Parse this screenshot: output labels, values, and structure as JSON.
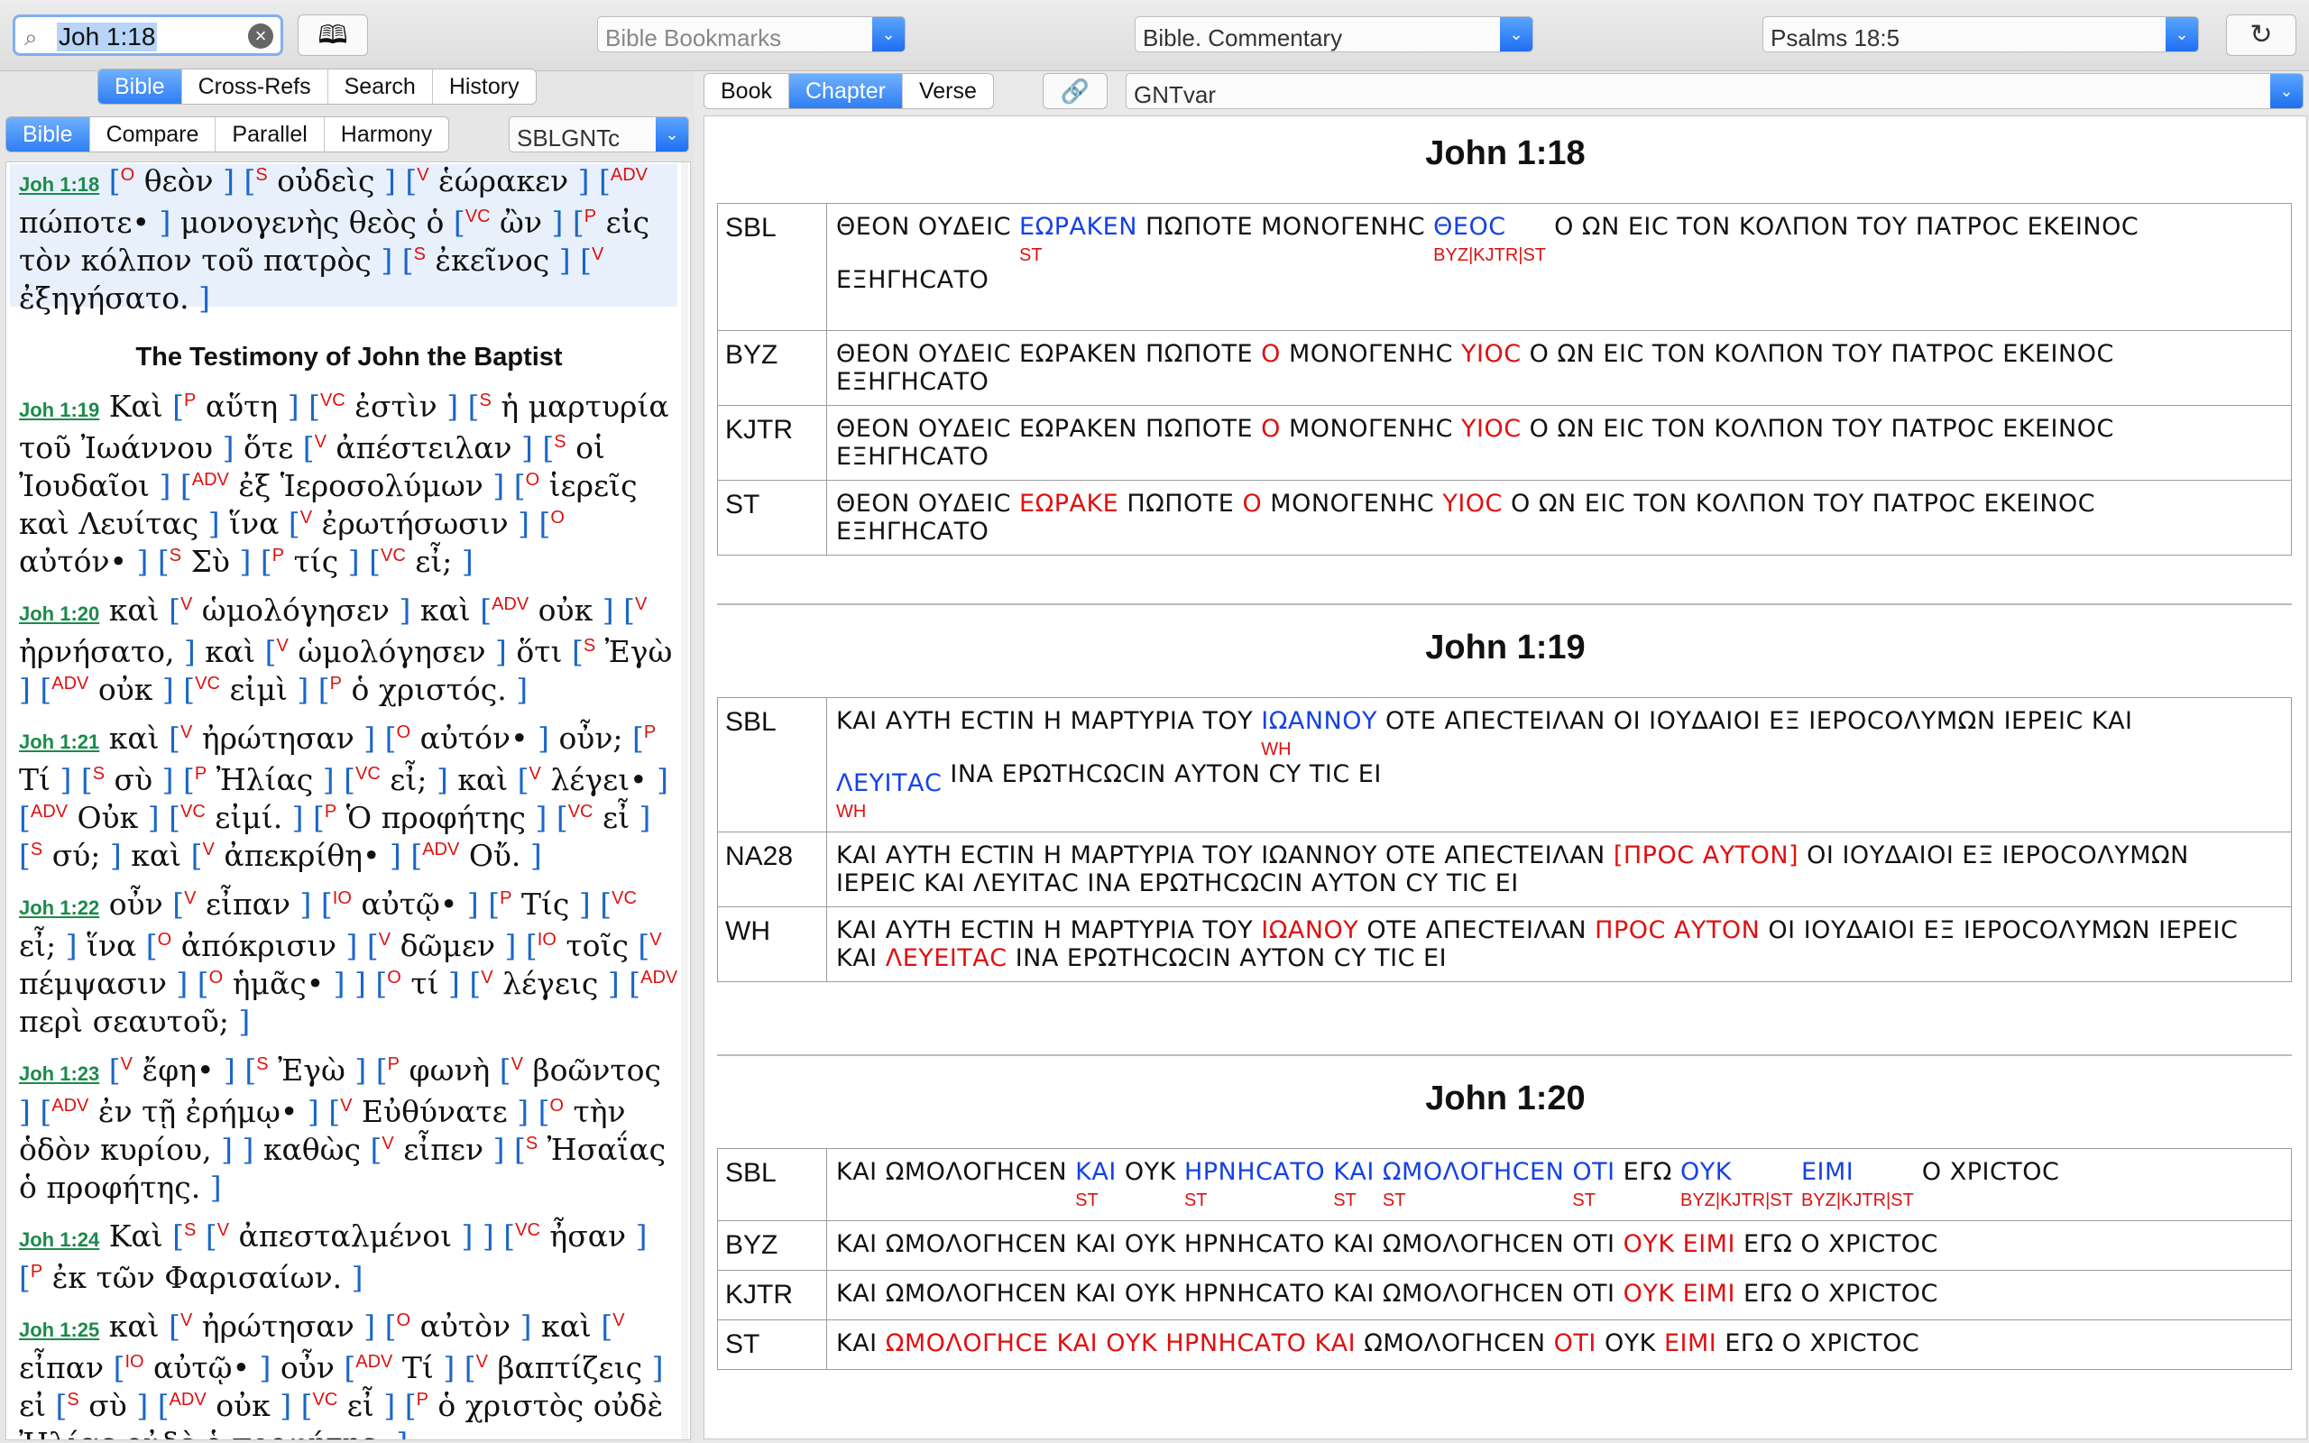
{
  "toolbar": {
    "search_value": "Joh 1:18",
    "bookmarks_placeholder": "Bible Bookmarks",
    "commentary_value": "Bible. Commentary",
    "passage_value": "Psalms 18:5"
  },
  "left": {
    "tabs": [
      "Bible",
      "Cross-Refs",
      "Search",
      "History"
    ],
    "subtabs": [
      "Bible",
      "Compare",
      "Parallel",
      "Harmony"
    ],
    "version": "SBLGNTc",
    "heading": "The Testimony of John the Baptist",
    "refs": [
      "Joh 1:18",
      "Joh 1:19",
      "Joh 1:20",
      "Joh 1:21",
      "Joh 1:22",
      "Joh 1:23",
      "Joh 1:24",
      "Joh 1:25"
    ]
  },
  "right": {
    "tabs": [
      "Book",
      "Chapter",
      "Verse"
    ],
    "version": "GNTvar",
    "verses": [
      {
        "title": "John 1:18",
        "rows": [
          {
            "src": "SBL",
            "text": "ΘΕΟΝ ΟΥΔΕΙϹ ΕΩΡΑΚΕΝ ΠΩΠΟΤΕ ΜΟΝΟΓΕΝΗϹ ΘΕΟϹ Ο ΩΝ ΕΙϹ ΤΟΝ ΚΟΛΠΟΝ ΤΟΥ ΠΑΤΡΟϹ ΕΚΕΙΝΟϹ ΕΞΗΓΗϹΑΤΟ",
            "notes": [
              "ST",
              "BYZ|KJTR|ST"
            ]
          },
          {
            "src": "BYZ",
            "text": "ΘΕΟΝ ΟΥΔΕΙϹ ΕΩΡΑΚΕΝ ΠΩΠΟΤΕ Ο ΜΟΝΟΓΕΝΗϹ ΥΙΟϹ Ο ΩΝ ΕΙϹ ΤΟΝ ΚΟΛΠΟΝ ΤΟΥ ΠΑΤΡΟϹ ΕΚΕΙΝΟϹ ΕΞΗΓΗϹΑΤΟ"
          },
          {
            "src": "KJTR",
            "text": "ΘΕΟΝ ΟΥΔΕΙϹ ΕΩΡΑΚΕΝ ΠΩΠΟΤΕ Ο ΜΟΝΟΓΕΝΗϹ ΥΙΟϹ Ο ΩΝ ΕΙϹ ΤΟΝ ΚΟΛΠΟΝ ΤΟΥ ΠΑΤΡΟϹ ΕΚΕΙΝΟϹ ΕΞΗΓΗϹΑΤΟ"
          },
          {
            "src": "ST",
            "text": "ΘΕΟΝ ΟΥΔΕΙϹ ΕΩΡΑΚΕ ΠΩΠΟΤΕ Ο ΜΟΝΟΓΕΝΗϹ ΥΙΟϹ Ο ΩΝ ΕΙϹ ΤΟΝ ΚΟΛΠΟΝ ΤΟΥ ΠΑΤΡΟϹ ΕΚΕΙΝΟϹ ΕΞΗΓΗϹΑΤΟ"
          }
        ]
      },
      {
        "title": "John 1:19",
        "rows": [
          {
            "src": "SBL",
            "text": "ΚΑΙ ΑΥΤΗ ΕϹΤΙΝ Η ΜΑΡΤΥΡΙΑ ΤΟΥ ΙΩΑΝΝΟΥ ΟΤΕ ΑΠΕϹΤΕΙΛΑΝ ΟΙ ΙΟΥΔΑΙΟΙ ΕΞ ΙΕΡΟϹΟΛΥΜΩΝ ΙΕΡΕΙϹ ΚΑΙ ΛΕΥΙΤΑϹ ΙΝΑ ΕΡΩΤΗϹΩϹΙΝ ΑΥΤΟΝ ϹΥ ΤΙϹ ΕΙ",
            "notes": [
              "WH",
              "WH"
            ]
          },
          {
            "src": "NA28",
            "text": "ΚΑΙ ΑΥΤΗ ΕϹΤΙΝ Η ΜΑΡΤΥΡΙΑ ΤΟΥ ΙΩΑΝΝΟΥ ΟΤΕ ΑΠΕϹΤΕΙΛΑΝ [ΠΡΟϹ ΑΥΤΟΝ] ΟΙ ΙΟΥΔΑΙΟΙ ΕΞ ΙΕΡΟϹΟΛΥΜΩΝ ΙΕΡΕΙϹ ΚΑΙ ΛΕΥΙΤΑϹ ΙΝΑ ΕΡΩΤΗϹΩϹΙΝ ΑΥΤΟΝ ϹΥ ΤΙϹ ΕΙ"
          },
          {
            "src": "WH",
            "text": "ΚΑΙ ΑΥΤΗ ΕϹΤΙΝ Η ΜΑΡΤΥΡΙΑ ΤΟΥ ΙΩΑΝΟΥ ΟΤΕ ΑΠΕϹΤΕΙΛΑΝ ΠΡΟϹ ΑΥΤΟΝ ΟΙ ΙΟΥΔΑΙΟΙ ΕΞ ΙΕΡΟϹΟΛΥΜΩΝ ΙΕΡΕΙϹ ΚΑΙ ΛΕΥΕΙΤΑϹ ΙΝΑ ΕΡΩΤΗϹΩϹΙΝ ΑΥΤΟΝ ϹΥ ΤΙϹ ΕΙ"
          }
        ]
      },
      {
        "title": "John 1:20",
        "rows": [
          {
            "src": "SBL",
            "text": "ΚΑΙ ΩΜΟΛΟΓΗϹΕΝ ΚΑΙ ΟΥΚ ΗΡΝΗϹΑΤΟ ΚΑΙ ΩΜΟΛΟΓΗϹΕΝ ΟΤΙ ΕΓΩ ΟΥΚ ΕΙΜΙ Ο ΧΡΙϹΤΟϹ",
            "notes": [
              "ST",
              "ST",
              "ST",
              "ST",
              "ST",
              "BYZ|KJTR|ST",
              "BYZ|KJTR|ST"
            ]
          },
          {
            "src": "BYZ",
            "text": "ΚΑΙ ΩΜΟΛΟΓΗϹΕΝ ΚΑΙ ΟΥΚ ΗΡΝΗϹΑΤΟ ΚΑΙ ΩΜΟΛΟΓΗϹΕΝ ΟΤΙ ΟΥΚ ΕΙΜΙ ΕΓΩ Ο ΧΡΙϹΤΟϹ"
          },
          {
            "src": "KJTR",
            "text": "ΚΑΙ ΩΜΟΛΟΓΗϹΕΝ ΚΑΙ ΟΥΚ ΗΡΝΗϹΑΤΟ ΚΑΙ ΩΜΟΛΟΓΗϹΕΝ ΟΤΙ ΟΥΚ ΕΙΜΙ ΕΓΩ Ο ΧΡΙϹΤΟϹ"
          },
          {
            "src": "ST",
            "text": "ΚΑΙ ΩΜΟΛΟΓΗϹΕ ΚΑΙ ΟΥΚ ΗΡΝΗϹΑΤΟ ΚΑΙ ΩΜΟΛΟΓΗϹΕΝ ΟΤΙ ΟΥΚ ΕΙΜΙ ΕΓΩ Ο ΧΡΙϹΤΟϹ"
          }
        ]
      }
    ]
  },
  "icons": {
    "search": "magnifier-icon",
    "clear": "clear-icon",
    "book": "open-book-icon",
    "sync": "sync-icon",
    "link": "link-icon",
    "dropdown": "chevron-down-icon"
  },
  "colors": {
    "accent": "#2f7ef2",
    "variant_blue": "#1542e6",
    "variant_red": "#e01010",
    "verse_ref_green": "#1c8a4a",
    "bracket_blue": "#1b66c8"
  }
}
